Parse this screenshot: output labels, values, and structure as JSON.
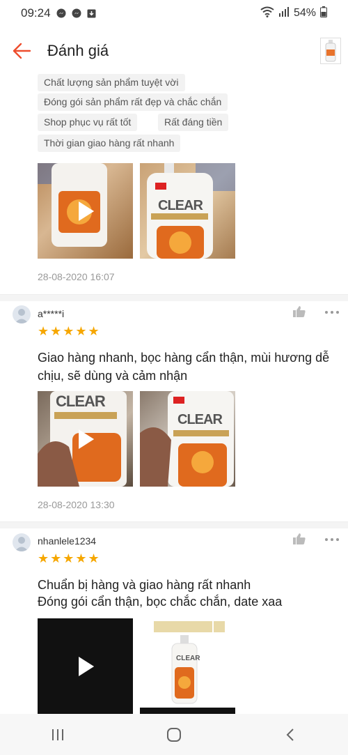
{
  "status_bar": {
    "time": "09:24",
    "battery": "54%"
  },
  "header": {
    "title": "Đánh giá"
  },
  "tags": [
    "Chất lượng sản phẩm tuyệt vời",
    "Đóng gói sản phẩm rất đẹp và chắc chắn",
    "Shop phục vụ rất tốt",
    "Rất đáng tiền",
    "Thời gian giao hàng rất nhanh"
  ],
  "reviews": [
    {
      "date": "28-08-2020 16:07"
    },
    {
      "username": "a*****i",
      "stars": "★★★★★",
      "rating": 5,
      "text": "Giao hàng nhanh, bọc hàng cẩn thận, mùi hương dễ chịu, sẽ dùng và cảm nhận",
      "date": "28-08-2020 13:30"
    },
    {
      "username": "nhanlele1234",
      "stars": "★★★★★",
      "rating": 5,
      "text_line1": "Chuẩn bị hàng và giao hàng rất nhanh",
      "text_line2": "Đóng gói cẩn thận, bọc chắc chắn, date xaa"
    }
  ],
  "product_brand": "CLEAR",
  "icons": {
    "back": "arrow-left-icon",
    "like": "thumbs-up-icon",
    "more": "more-dots-icon",
    "play": "play-icon"
  },
  "colors": {
    "accent": "#ee4d2d",
    "star": "#f6a700"
  }
}
